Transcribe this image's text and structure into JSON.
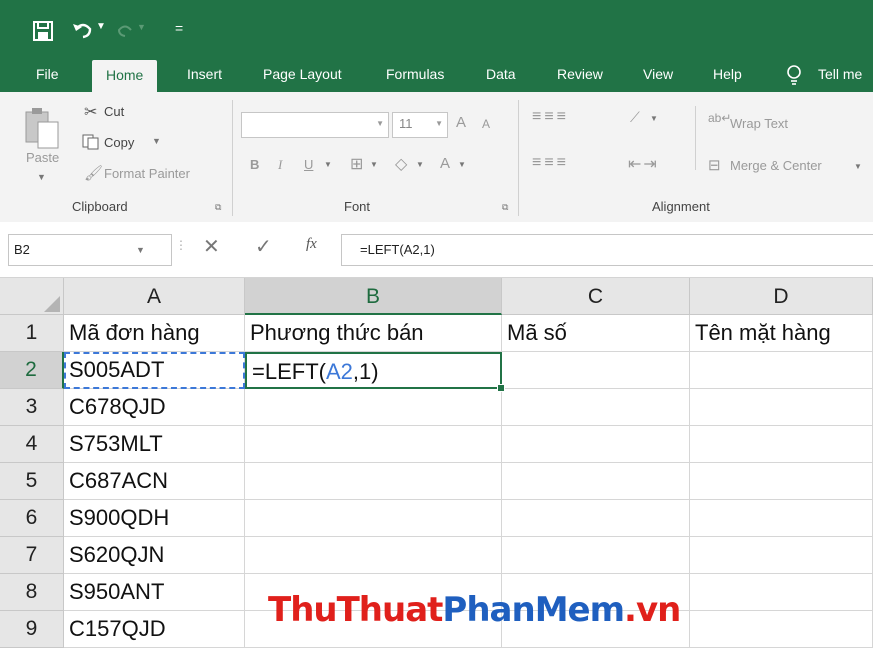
{
  "qat": {
    "save_icon": "save-icon",
    "undo_icon": "undo-icon",
    "redo_icon": "redo-icon",
    "customize_icon": "customize-qat-icon"
  },
  "tabs": [
    "File",
    "Home",
    "Insert",
    "Page Layout",
    "Formulas",
    "Data",
    "Review",
    "View",
    "Help",
    "Tell me"
  ],
  "active_tab": "Home",
  "ribbon": {
    "clipboard": {
      "paste": "Paste",
      "cut": "Cut",
      "copy": "Copy",
      "format_painter": "Format Painter",
      "label": "Clipboard"
    },
    "font": {
      "name": "",
      "size": "11",
      "grow": "A",
      "shrink": "A",
      "bold": "B",
      "italic": "I",
      "underline": "U",
      "font_color": "A",
      "label": "Font"
    },
    "alignment": {
      "wrap_text": "Wrap Text",
      "merge_center": "Merge & Center",
      "label": "Alignment"
    }
  },
  "formula_bar": {
    "name_box": "B2",
    "fx": "fx",
    "formula": "=LEFT(A2,1)"
  },
  "grid": {
    "columns": [
      "A",
      "B",
      "C",
      "D"
    ],
    "selected_column": "B",
    "rows": [
      "1",
      "2",
      "3",
      "4",
      "5",
      "6",
      "7",
      "8",
      "9"
    ],
    "selected_row": "2",
    "headers": [
      "Mã đơn hàng",
      "Phương thức bán",
      "Mã số",
      "Tên mặt hàng"
    ],
    "col_a": [
      "S005ADT",
      "C678QJD",
      "S753MLT",
      "C687ACN",
      "S900QDH",
      "S620QJN",
      "S950ANT",
      "C157QJD"
    ],
    "edit_cell": {
      "prefix": "=LEFT(",
      "ref": "A2",
      "suffix": ",1)"
    }
  },
  "watermark": {
    "part1": "Thu",
    "part2": "Thuat",
    "part3": "Phan",
    "part4": "Mem",
    "part5": ".vn"
  },
  "colors": {
    "excel_green": "#217346",
    "ref_blue": "#3c78d8",
    "watermark_red": "#e0201b",
    "watermark_blue": "#1f5fbf"
  }
}
